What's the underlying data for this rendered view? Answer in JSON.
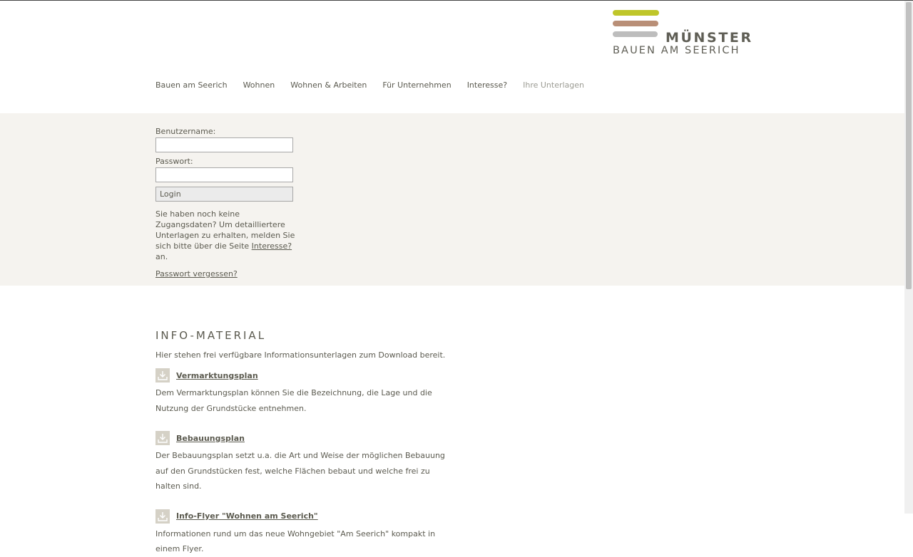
{
  "logo": {
    "title": "MÜNSTER",
    "subtitle": "BAUEN AM SEERICH",
    "bar_colors": [
      "#bfc62a",
      "#b98f77",
      "#bdbdbd"
    ]
  },
  "nav": {
    "items": [
      {
        "label": "Bauen am Seerich"
      },
      {
        "label": "Wohnen"
      },
      {
        "label": "Wohnen & Arbeiten"
      },
      {
        "label": "Für Unternehmen"
      },
      {
        "label": "Interesse?"
      },
      {
        "label": "Ihre Unterlagen"
      }
    ]
  },
  "login": {
    "username_label": "Benutzername:",
    "username_value": "",
    "password_label": "Passwort:",
    "password_value": "",
    "button_label": "Login",
    "help_text_before": "Sie haben noch keine Zugangsdaten? Um detailliertere Unterlagen zu erhalten, melden Sie sich bitte über die Seite ",
    "help_link": "Interesse?",
    "help_text_after": " an.",
    "forgot_link": "Passwort vergessen?"
  },
  "info": {
    "heading": "INFO-MATERIAL",
    "lead": "Hier stehen frei verfügbare Informationsunterlagen zum Download bereit.",
    "items": [
      {
        "title": "Vermarktungsplan",
        "description": "Dem Vermarktungsplan können Sie die Bezeichnung, die Lage und die Nutzung der Grundstücke entnehmen."
      },
      {
        "title": "Bebauungsplan",
        "description": "Der Bebauungsplan setzt u.a. die Art und Weise der möglichen Bebauung auf den Grundstücken fest, welche Flächen bebaut und welche frei zu halten sind."
      },
      {
        "title": "Info-Flyer \"Wohnen am Seerich\"",
        "description": "Informationen rund um das neue Wohngebiet \"Am Seerich\" kompakt in einem Flyer."
      }
    ]
  },
  "colors": {
    "background_band": "#f5f3ef",
    "text": "#5b5a4f",
    "icon_bg": "#d5d1c6"
  }
}
